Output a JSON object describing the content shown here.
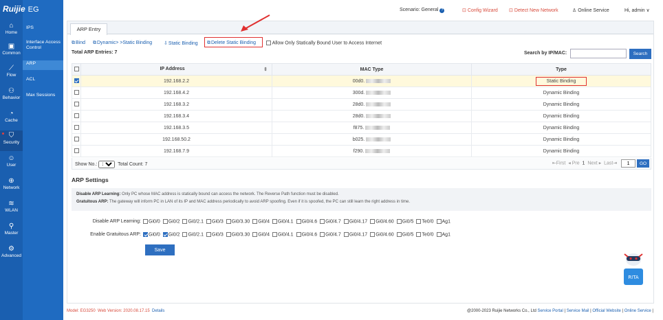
{
  "brand": {
    "logo": "Ruijie",
    "product": "EG"
  },
  "rail": [
    {
      "label": "Home",
      "icon": "home-icon",
      "glyph": "⌂"
    },
    {
      "label": "Common",
      "icon": "briefcase-icon",
      "glyph": "▣"
    },
    {
      "label": "Flow",
      "icon": "chart-icon",
      "glyph": "⟋"
    },
    {
      "label": "Behavior",
      "icon": "behavior-icon",
      "glyph": "⚇"
    },
    {
      "label": "Cache",
      "icon": "gauge-icon",
      "glyph": "◔"
    },
    {
      "label": "Security",
      "icon": "shield-icon",
      "glyph": "⛉"
    },
    {
      "label": "User",
      "icon": "user-icon",
      "glyph": "☺"
    },
    {
      "label": "Network",
      "icon": "globe-icon",
      "glyph": "⊕"
    },
    {
      "label": "WLAN",
      "icon": "wifi-icon",
      "glyph": "≋"
    },
    {
      "label": "Master",
      "icon": "network-icon",
      "glyph": "⚲"
    },
    {
      "label": "Advanced",
      "icon": "gear-icon",
      "glyph": "⚙"
    }
  ],
  "submenu": [
    "IPS",
    "Interface Access Control",
    "ARP",
    "ACL",
    "Max Sessions"
  ],
  "topbar": {
    "scenario_label": "Scenario:",
    "scenario_value": "General",
    "config_wizard": "Config Wizard",
    "detect_network": "Detect New Network",
    "online_service": "Online Service",
    "greeting": "Hi, admin"
  },
  "tab": "ARP Entry",
  "toolbar": {
    "bind": "Bind",
    "dynamic_to_static": "Dynamic> >Static Binding",
    "static_binding": "Static Binding",
    "delete_static": "Delete Static Binding",
    "only_static": "Allow Only Statically Bound User to Access Internet"
  },
  "total_label": "Total ARP Entries: 7",
  "search": {
    "label": "Search by IP/MAC:",
    "value": "",
    "button": "Search"
  },
  "table": {
    "headers": [
      "IP Address",
      "MAC Type",
      "Type"
    ],
    "rows": [
      {
        "ip": "192.168.2.2",
        "mac": "00d0.",
        "type": "Static Binding",
        "checked": true
      },
      {
        "ip": "192.168.4.2",
        "mac": "300d.",
        "type": "Dynamic Binding",
        "checked": false
      },
      {
        "ip": "192.168.3.2",
        "mac": "28d0.",
        "type": "Dynamic Binding",
        "checked": false
      },
      {
        "ip": "192.168.3.4",
        "mac": "28d0.",
        "type": "Dynamic Binding",
        "checked": false
      },
      {
        "ip": "192.168.3.5",
        "mac": "f875.",
        "type": "Dynamic Binding",
        "checked": false
      },
      {
        "ip": "192.168.50.2",
        "mac": "b025.",
        "type": "Dynamic Binding",
        "checked": false
      },
      {
        "ip": "192.168.7.9",
        "mac": "f290.",
        "type": "Dynamic Binding",
        "checked": false
      }
    ]
  },
  "pager": {
    "show_no": "Show No.:",
    "page_size": "10",
    "total_count": "Total Count: 7",
    "first": "First",
    "prev": "Pre",
    "page_num": "1",
    "next": "Next",
    "last": "Last",
    "page_input": "1",
    "go": "GO"
  },
  "arp_settings": {
    "title": "ARP Settings",
    "info_line1_bold": "Disable ARP Learning:",
    "info_line1": " Only PC whose MAC address is statically bound can access the network. The Reverse Path function must be disabled.",
    "info_line2_bold": "Gratuitous ARP:",
    "info_line2": " The gateway will inform PC in LAN of its IP and MAC address periodically to avoid ARP spoofing. Even if it is spoofed, the PC can still learn the right address in time.",
    "disable_label": "Disable ARP Learning:",
    "gratuitous_label": "Enable Gratuitous ARP:",
    "ports": [
      "Gi0/0",
      "Gi0/2",
      "Gi0/2.1",
      "Gi0/3",
      "Gi0/3.30",
      "Gi0/4",
      "Gi0/4.1",
      "Gi0/4.6",
      "Gi0/4.7",
      "Gi0/4.17",
      "Gi0/4.60",
      "Gi0/5",
      "Te0/0",
      "Ag1"
    ],
    "disable_checked": [],
    "gratuitous_checked": [
      "Gi0/0",
      "Gi0/2"
    ],
    "save": "Save"
  },
  "footer": {
    "model": "Model: EG3250",
    "web_version": "Web Version: 2020.08.17.15",
    "details": "Details",
    "copyright": "@2000-2023 Ruijie Networks Co., Ltd",
    "service_portal": "Service Portal",
    "service_mail": "Service Mail",
    "official_website": "Official Website",
    "online_service": "Online Service"
  },
  "rita_label": "RITA",
  "colors": {
    "rail": "#1a5fb0",
    "submenu": "#1f6bc1",
    "accent": "#2e6fc0",
    "highlight": "#e03030"
  }
}
